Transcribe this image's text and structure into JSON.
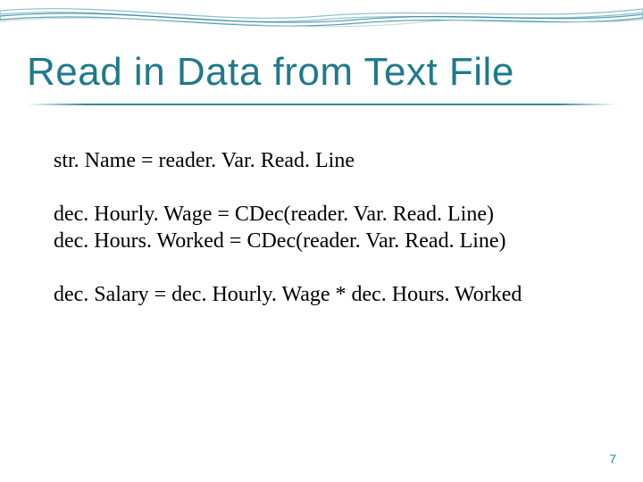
{
  "title": "Read in Data from Text File",
  "code": {
    "line1": "str. Name = reader. Var. Read. Line",
    "line2a": "dec. Hourly. Wage = CDec(reader. Var. Read. Line)",
    "line2b": "dec. Hours. Worked = CDec(reader. Var. Read. Line)",
    "line3": "dec. Salary = dec. Hourly. Wage * dec. Hours. Worked"
  },
  "page_number": "7"
}
